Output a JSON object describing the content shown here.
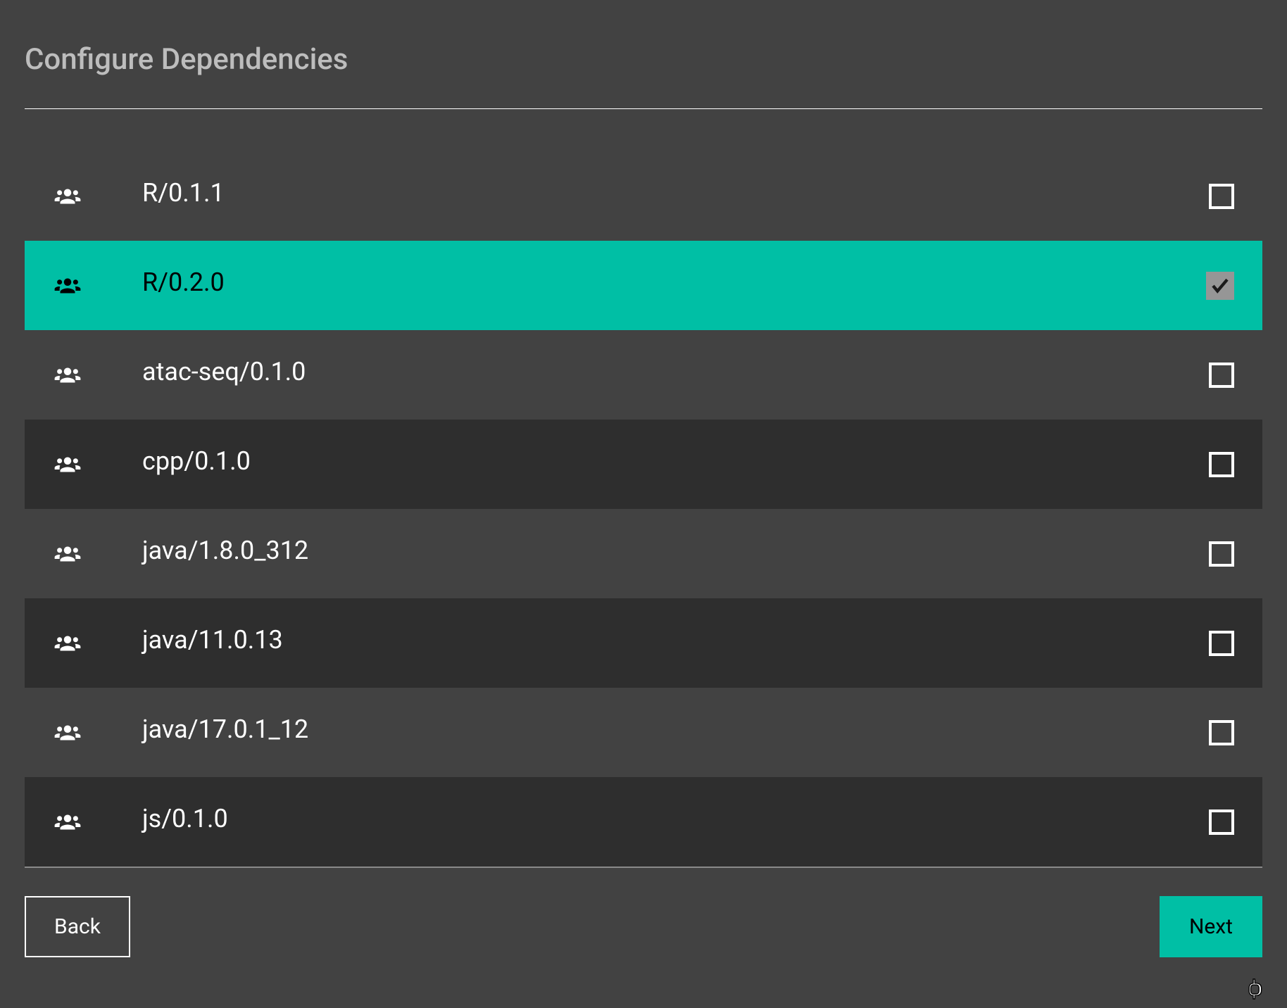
{
  "title": "Configure Dependencies",
  "dependencies": [
    {
      "label": "R/0.1.1",
      "selected": false
    },
    {
      "label": "R/0.2.0",
      "selected": true
    },
    {
      "label": "atac-seq/0.1.0",
      "selected": false
    },
    {
      "label": "cpp/0.1.0",
      "selected": false
    },
    {
      "label": "java/1.8.0_312",
      "selected": false
    },
    {
      "label": "java/11.0.13",
      "selected": false
    },
    {
      "label": "java/17.0.1_12",
      "selected": false
    },
    {
      "label": "js/0.1.0",
      "selected": false
    }
  ],
  "buttons": {
    "back": "Back",
    "next": "Next"
  },
  "colors": {
    "accent": "#00bfa5",
    "bg": "#424242",
    "altRow": "#2e2e2e"
  }
}
